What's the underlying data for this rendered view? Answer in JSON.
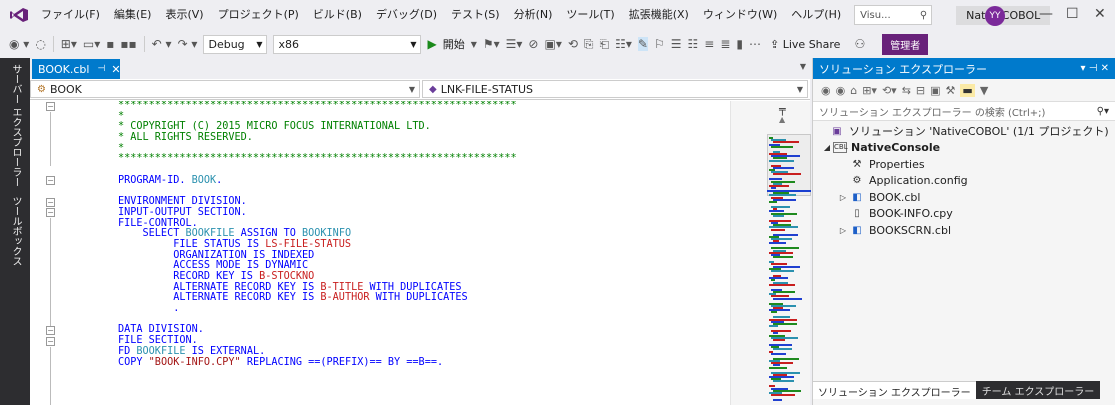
{
  "menu": {
    "items": [
      "ファイル(F)",
      "編集(E)",
      "表示(V)",
      "プロジェクト(P)",
      "ビルド(B)",
      "デバッグ(D)",
      "テスト(S)",
      "分析(N)",
      "ツール(T)",
      "拡張機能(X)",
      "ウィンドウ(W)",
      "ヘルプ(H)"
    ],
    "search_text": "Visu...",
    "solution_name": "NativeCOBOL",
    "avatar_initials": "YY"
  },
  "toolbar": {
    "config": "Debug",
    "platform": "x86",
    "start_label": "開始",
    "live_share": "Live Share",
    "admin_label": "管理者"
  },
  "left_strip": {
    "tab1": "サーバー エクスプローラー",
    "tab2": "ツールボックス"
  },
  "editor": {
    "tab_name": "BOOK.cbl",
    "nav_left": "BOOK",
    "nav_right": "LNK-FILE-STATUS",
    "lines": [
      [
        {
          "t": "*****************************************************************",
          "c": "c-green"
        }
      ],
      [
        {
          "t": "*",
          "c": "c-green"
        }
      ],
      [
        {
          "t": "* COPYRIGHT (C) 2015 MICRO FOCUS INTERNATIONAL LTD.",
          "c": "c-green"
        }
      ],
      [
        {
          "t": "* ALL RIGHTS RESERVED.",
          "c": "c-green"
        }
      ],
      [
        {
          "t": "*",
          "c": "c-green"
        }
      ],
      [
        {
          "t": "*****************************************************************",
          "c": "c-green"
        }
      ],
      [
        {
          "t": "",
          "c": ""
        }
      ],
      [
        {
          "t": "PROGRAM-ID. ",
          "c": "c-blue"
        },
        {
          "t": "BOOK",
          "c": "c-teal"
        },
        {
          "t": ".",
          "c": "c-blue"
        }
      ],
      [
        {
          "t": "",
          "c": ""
        }
      ],
      [
        {
          "t": "ENVIRONMENT DIVISION.",
          "c": "c-blue"
        }
      ],
      [
        {
          "t": "INPUT-OUTPUT SECTION.",
          "c": "c-blue"
        }
      ],
      [
        {
          "t": "FILE-CONTROL.",
          "c": "c-blue"
        }
      ],
      [
        {
          "t": "    SELECT ",
          "c": "c-blue"
        },
        {
          "t": "BOOKFILE",
          "c": "c-teal"
        },
        {
          "t": " ASSIGN TO ",
          "c": "c-blue"
        },
        {
          "t": "BOOKINFO",
          "c": "c-teal"
        }
      ],
      [
        {
          "t": "         FILE STATUS IS ",
          "c": "c-blue"
        },
        {
          "t": "LS-FILE-STATUS",
          "c": "c-red"
        }
      ],
      [
        {
          "t": "         ORGANIZATION IS INDEXED",
          "c": "c-blue"
        }
      ],
      [
        {
          "t": "         ACCESS MODE IS DYNAMIC",
          "c": "c-blue"
        }
      ],
      [
        {
          "t": "         RECORD KEY IS ",
          "c": "c-blue"
        },
        {
          "t": "B-STOCKNO",
          "c": "c-red"
        }
      ],
      [
        {
          "t": "         ALTERNATE RECORD KEY IS ",
          "c": "c-blue"
        },
        {
          "t": "B-TITLE",
          "c": "c-red"
        },
        {
          "t": " WITH DUPLICATES",
          "c": "c-blue"
        }
      ],
      [
        {
          "t": "         ALTERNATE RECORD KEY IS ",
          "c": "c-blue"
        },
        {
          "t": "B-AUTHOR",
          "c": "c-red"
        },
        {
          "t": " WITH DUPLICATES",
          "c": "c-blue"
        }
      ],
      [
        {
          "t": "         .",
          "c": "c-blue"
        }
      ],
      [
        {
          "t": "",
          "c": ""
        }
      ],
      [
        {
          "t": "DATA DIVISION.",
          "c": "c-blue"
        }
      ],
      [
        {
          "t": "FILE SECTION.",
          "c": "c-blue"
        }
      ],
      [
        {
          "t": "FD ",
          "c": "c-blue"
        },
        {
          "t": "BOOKFILE",
          "c": "c-teal"
        },
        {
          "t": " IS EXTERNAL.",
          "c": "c-blue"
        }
      ],
      [
        {
          "t": "COPY ",
          "c": "c-blue"
        },
        {
          "t": "\"BOOK-INFO.CPY\"",
          "c": "c-brown"
        },
        {
          "t": " REPLACING ==(PREFIX)== BY ==B==.",
          "c": "c-blue"
        }
      ]
    ]
  },
  "solution_explorer": {
    "title": "ソリューション エクスプローラー",
    "search_placeholder": "ソリューション エクスプローラー の検索 (Ctrl+;)",
    "solution_label": "ソリューション 'NativeCOBOL' (1/1 プロジェクト)",
    "project_label": "NativeConsole",
    "items": [
      "Properties",
      "Application.config",
      "BOOK.cbl",
      "BOOK-INFO.cpy",
      "BOOKSCRN.cbl"
    ],
    "bottom_tab_active": "ソリューション エクスプローラー",
    "bottom_tab_other": "チーム エクスプローラー"
  }
}
